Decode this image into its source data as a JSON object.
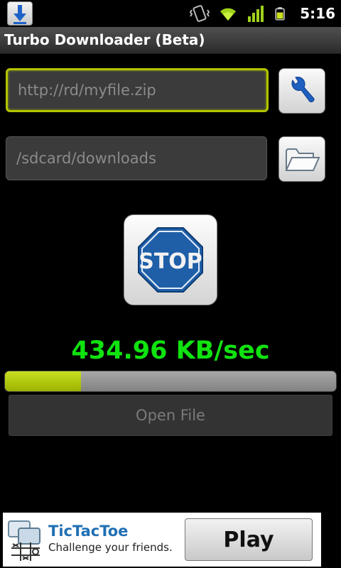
{
  "status_bar": {
    "time": "5:16",
    "icons": [
      "download-notification-icon",
      "vibrate-icon",
      "wifi-icon",
      "signal-icon",
      "battery-icon"
    ],
    "battery_color": "#c8e020",
    "signal_color": "#9fd21a"
  },
  "app": {
    "title": "Turbo Downloader (Beta)"
  },
  "form": {
    "url_value": "http://rd/myfile.zip",
    "path_value": "/sdcard/downloads"
  },
  "stop_button": {
    "label": "STOP"
  },
  "download": {
    "speed": "434.96 KB/sec",
    "progress_fraction": 0.23,
    "speed_color": "#10e310",
    "progress_color": "#b4cc10"
  },
  "open_file_button": {
    "label": "Open File"
  },
  "ad": {
    "title": "TicTacToe",
    "subtitle": "Challenge your friends.",
    "play_label": "Play"
  }
}
